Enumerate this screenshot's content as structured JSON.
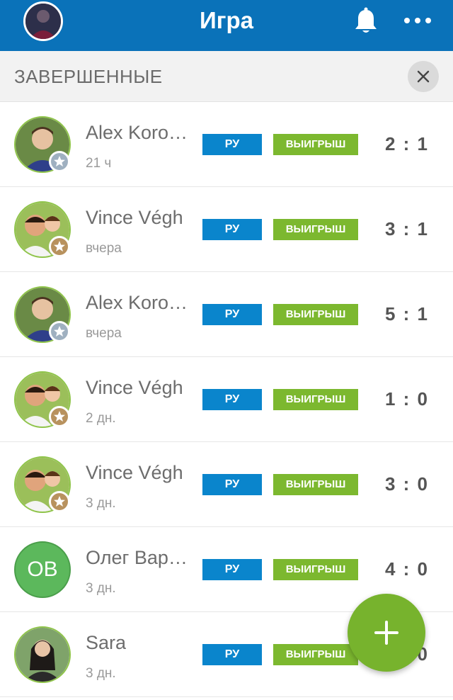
{
  "header": {
    "title": "Игра",
    "avatar_icon": "user-avatar-icon",
    "bell_icon": "bell-icon",
    "more_icon": "more-dots-icon"
  },
  "section": {
    "title": "ЗАВЕРШЕННЫЕ",
    "close_icon": "close-icon"
  },
  "colors": {
    "header_bg": "#0a72b9",
    "lang_badge": "#0a85cc",
    "result_badge": "#7cb82f",
    "fab": "#77b32d"
  },
  "games": [
    {
      "name": "Alex Koro…",
      "time": "21 ч",
      "lang": "РУ",
      "result": "ВЫИГРЫШ",
      "score": "2 : 1",
      "avatar": "photo",
      "badge": "silver-star"
    },
    {
      "name": "Vince Végh",
      "time": "вчера",
      "lang": "РУ",
      "result": "ВЫИГРЫШ",
      "score": "3 : 1",
      "avatar": "photo",
      "badge": "bronze-star"
    },
    {
      "name": "Alex Koro…",
      "time": "вчера",
      "lang": "РУ",
      "result": "ВЫИГРЫШ",
      "score": "5 : 1",
      "avatar": "photo",
      "badge": "silver-star"
    },
    {
      "name": "Vince Végh",
      "time": "2 дн.",
      "lang": "РУ",
      "result": "ВЫИГРЫШ",
      "score": "1 : 0",
      "avatar": "photo",
      "badge": "bronze-star"
    },
    {
      "name": "Vince Végh",
      "time": "3 дн.",
      "lang": "РУ",
      "result": "ВЫИГРЫШ",
      "score": "3 : 0",
      "avatar": "photo",
      "badge": "bronze-star"
    },
    {
      "name": "Олег Вар…",
      "time": "3 дн.",
      "lang": "РУ",
      "result": "ВЫИГРЫШ",
      "score": "4 : 0",
      "avatar": "initials",
      "initials": "OB"
    },
    {
      "name": "Sara",
      "time": "3 дн.",
      "lang": "РУ",
      "result": "ВЫИГРЫШ",
      "score": "? : 0",
      "avatar": "photo"
    }
  ],
  "fab": {
    "icon": "plus-icon"
  }
}
